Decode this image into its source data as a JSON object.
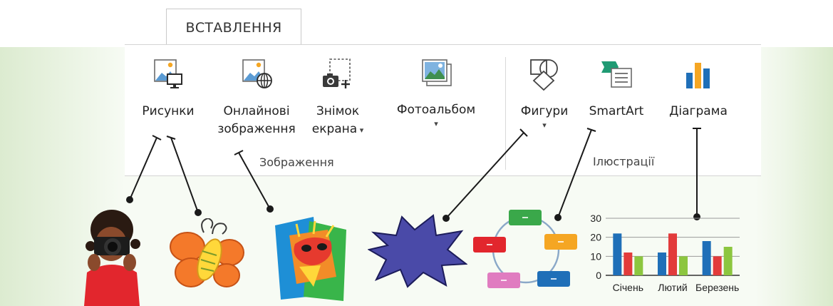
{
  "ribbon": {
    "tab": {
      "label": "ВСТАВЛЕННЯ"
    },
    "groups": [
      {
        "label": "Зображення",
        "buttons": [
          {
            "line1": "Рисунки",
            "line2": "",
            "icon": "pictures-icon"
          },
          {
            "line1": "Онлайнові",
            "line2": "зображення",
            "icon": "online-pictures-icon"
          },
          {
            "line1": "Знімок",
            "line2": "екрана",
            "icon": "screenshot-icon",
            "has_dropdown": true
          },
          {
            "line1": "Фотоальбом",
            "line2": "",
            "icon": "photo-album-icon",
            "has_dropdown": true
          }
        ]
      },
      {
        "label": "Ілюстрації",
        "buttons": [
          {
            "line1": "Фигури",
            "line2": "",
            "icon": "shapes-icon",
            "has_dropdown": true
          },
          {
            "line1": "SmartArt",
            "line2": "",
            "icon": "smartart-icon"
          },
          {
            "line1": "Діаграма",
            "line2": "",
            "icon": "chart-icon"
          }
        ]
      }
    ]
  },
  "colors": {
    "blue": "#1f6fb8",
    "red": "#e23b3b",
    "green": "#8cc63f",
    "orange": "#f5a623",
    "band": "#eef6e8"
  },
  "examples": {
    "photo": "photo-illustration",
    "drawing": "butterfly-drawing",
    "online_image": "carnival-mask-image",
    "shape": "explosion-shape",
    "smartart": "cycle-diagram",
    "chart": "bar-chart-sample"
  },
  "chart_data": {
    "type": "bar",
    "categories": [
      "Січень",
      "Лютий",
      "Березень"
    ],
    "series": [
      {
        "values": [
          22,
          12,
          18
        ],
        "color": "#1f6fb8"
      },
      {
        "values": [
          12,
          22,
          10
        ],
        "color": "#e23b3b"
      },
      {
        "values": [
          10,
          10,
          15
        ],
        "color": "#8cc63f"
      }
    ],
    "yticks": [
      0,
      10,
      20,
      30
    ],
    "ylim": [
      0,
      30
    ],
    "grid": true
  }
}
